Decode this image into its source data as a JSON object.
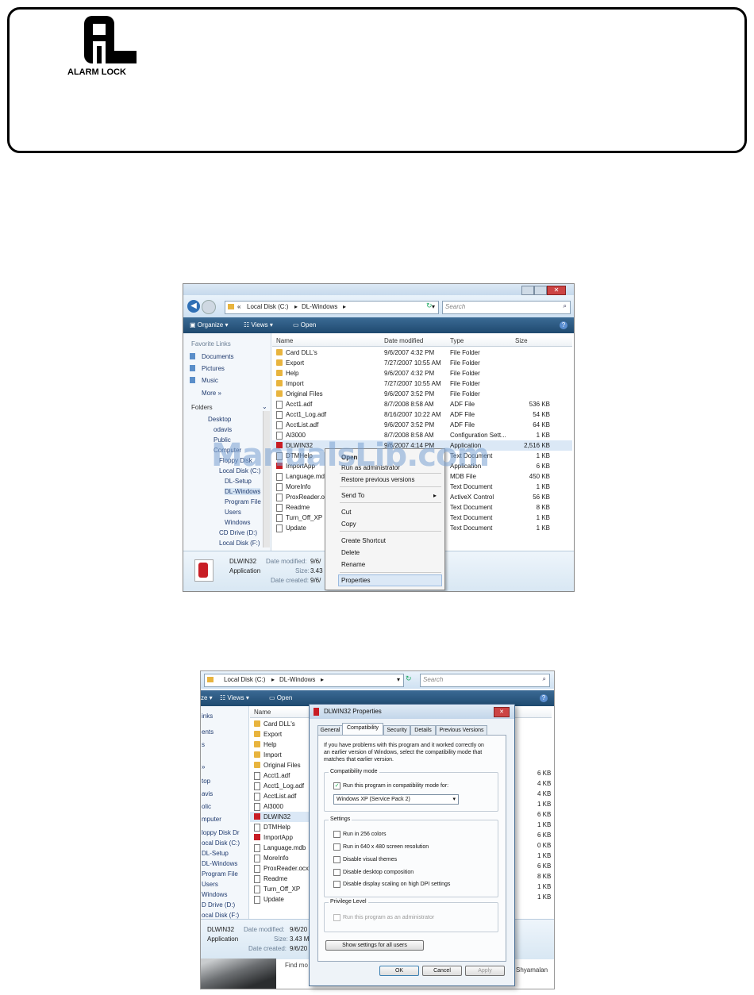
{
  "header": {
    "brand_name": "ALARM LOCK"
  },
  "watermark": "ManualsLib.com",
  "screenshot1": {
    "address": {
      "back_chevrons": "«",
      "crumb1": "Local Disk (C:)",
      "sep1": "▸",
      "crumb2": "DL-Windows",
      "sep2": "▸"
    },
    "search_placeholder": "Search",
    "toolbar": {
      "organize": "Organize",
      "views": "Views",
      "open": "Open"
    },
    "nav": {
      "favorite_links": "Favorite Links",
      "links": [
        "Documents",
        "Pictures",
        "Music"
      ],
      "more": "More »",
      "folders": "Folders",
      "tree": [
        "Desktop",
        "odavis",
        "Public",
        "Computer",
        "Floppy Disk",
        "Local Disk (C:)",
        "DL-Setup",
        "DL-Windows",
        "Program File",
        "Users",
        "Windows",
        "CD Drive (D:)",
        "Local Disk (F:)"
      ]
    },
    "columns": {
      "name": "Name",
      "date": "Date modified",
      "type": "Type",
      "size": "Size"
    },
    "files": [
      {
        "name": "Card DLL's",
        "date": "9/6/2007 4:32 PM",
        "type": "File Folder",
        "size": "",
        "icon": "folder"
      },
      {
        "name": "Export",
        "date": "7/27/2007 10:55 AM",
        "type": "File Folder",
        "size": "",
        "icon": "folder"
      },
      {
        "name": "Help",
        "date": "9/6/2007 4:32 PM",
        "type": "File Folder",
        "size": "",
        "icon": "folder"
      },
      {
        "name": "Import",
        "date": "7/27/2007 10:55 AM",
        "type": "File Folder",
        "size": "",
        "icon": "folder"
      },
      {
        "name": "Original Files",
        "date": "9/6/2007 3:52 PM",
        "type": "File Folder",
        "size": "",
        "icon": "folder"
      },
      {
        "name": "Acct1.adf",
        "date": "8/7/2008 8:58 AM",
        "type": "ADF File",
        "size": "536 KB",
        "icon": "doc"
      },
      {
        "name": "Acct1_Log.adf",
        "date": "8/16/2007 10:22 AM",
        "type": "ADF File",
        "size": "54 KB",
        "icon": "doc"
      },
      {
        "name": "AcctList.adf",
        "date": "9/6/2007 3:52 PM",
        "type": "ADF File",
        "size": "64 KB",
        "icon": "doc"
      },
      {
        "name": "Al3000",
        "date": "8/7/2008 8:58 AM",
        "type": "Configuration Sett...",
        "size": "1 KB",
        "icon": "doc"
      },
      {
        "name": "DLWIN32",
        "date": "9/6/2007 4:14 PM",
        "type": "Application",
        "size": "2,516 KB",
        "icon": "app"
      },
      {
        "name": "DTMHelp",
        "date": "",
        "type": "Text Document",
        "size": "1 KB",
        "icon": "doc"
      },
      {
        "name": "ImportApp",
        "date": "",
        "type": "Application",
        "size": "6 KB",
        "icon": "app"
      },
      {
        "name": "Language.mdb",
        "date": "",
        "type": "MDB File",
        "size": "450 KB",
        "icon": "doc"
      },
      {
        "name": "MoreInfo",
        "date": "",
        "type": "Text Document",
        "size": "1 KB",
        "icon": "doc"
      },
      {
        "name": "ProxReader.ocx",
        "date": "",
        "type": "ActiveX Control",
        "size": "56 KB",
        "icon": "doc"
      },
      {
        "name": "Readme",
        "date": "",
        "type": "Text Document",
        "size": "8 KB",
        "icon": "doc"
      },
      {
        "name": "Turn_Off_XP",
        "date": "",
        "type": "Text Document",
        "size": "1 KB",
        "icon": "doc"
      },
      {
        "name": "Update",
        "date": "",
        "type": "Text Document",
        "size": "1 KB",
        "icon": "doc"
      }
    ],
    "context_menu": [
      "Open",
      "Run as administrator",
      "Restore previous versions",
      "Send To",
      "Cut",
      "Copy",
      "Create Shortcut",
      "Delete",
      "Rename",
      "Properties"
    ],
    "details": {
      "name": "DLWIN32",
      "kind": "Application",
      "modified_label": "Date modified:",
      "modified_value": "9/6/",
      "size_label": "Size:",
      "size_value": "3.43",
      "created_label": "Date created:",
      "created_value": "9/6/"
    }
  },
  "screenshot2": {
    "address": {
      "crumb1": "Local Disk (C:)",
      "sep1": "▸",
      "crumb2": "DL-Windows",
      "sep2": "▸"
    },
    "search_placeholder": "Search",
    "toolbar": {
      "organize": "ze",
      "views": "Views",
      "open": "Open"
    },
    "nav_partial": [
      "inks",
      "ents",
      "s",
      "»",
      "top",
      "avis",
      "olic",
      "mputer",
      "loppy Disk Dr",
      "ocal Disk (C:)",
      "DL-Setup",
      "DL-Windows",
      "Program File",
      "Users",
      "Windows",
      "D Drive (D:)",
      "ocal Disk (F:)"
    ],
    "column_name": "Name",
    "files": [
      "Card DLL's",
      "Export",
      "Help",
      "Import",
      "Original Files",
      "Acct1.adf",
      "Acct1_Log.adf",
      "AcctList.adf",
      "Al3000",
      "DLWIN32",
      "DTMHelp",
      "ImportApp",
      "Language.mdb",
      "MoreInfo",
      "ProxReader.ocx",
      "Readme",
      "Turn_Off_XP",
      "Update"
    ],
    "sizes_partial": [
      "6 KB",
      "4 KB",
      "4 KB",
      "1 KB",
      "6 KB",
      "1 KB",
      "6 KB",
      "0 KB",
      "1 KB",
      "6 KB",
      "8 KB",
      "1 KB",
      "1 KB"
    ],
    "details": {
      "name": "DLWIN32",
      "kind": "Application",
      "modified_label": "Date modified:",
      "modified_value": "9/6/20",
      "size_label": "Size:",
      "size_value": "3.43 MI",
      "created_label": "Date created:",
      "created_value": "9/6/20"
    },
    "bottom_strip": {
      "find": "Find mo",
      "name": "Shyamalan"
    },
    "dialog": {
      "title": "DLWIN32 Properties",
      "tabs": [
        "General",
        "Compatibility",
        "Security",
        "Details",
        "Previous Versions"
      ],
      "intro": [
        "If you have problems with this program and it worked correctly on",
        "an earlier version of Windows, select the compatibility mode that",
        "matches that earlier version."
      ],
      "compat_group": "Compatibility mode",
      "compat_check": "Run this program in compatibility mode for:",
      "compat_select": "Windows XP (Service Pack 2)",
      "settings_group": "Settings",
      "settings": [
        "Run in 256 colors",
        "Run in 640 x 480 screen resolution",
        "Disable visual themes",
        "Disable desktop composition",
        "Disable display scaling on high DPI settings"
      ],
      "privilege_group": "Privilege Level",
      "privilege_check": "Run this program as an administrator",
      "show_all": "Show settings for all users",
      "ok": "OK",
      "cancel": "Cancel",
      "apply": "Apply"
    }
  }
}
